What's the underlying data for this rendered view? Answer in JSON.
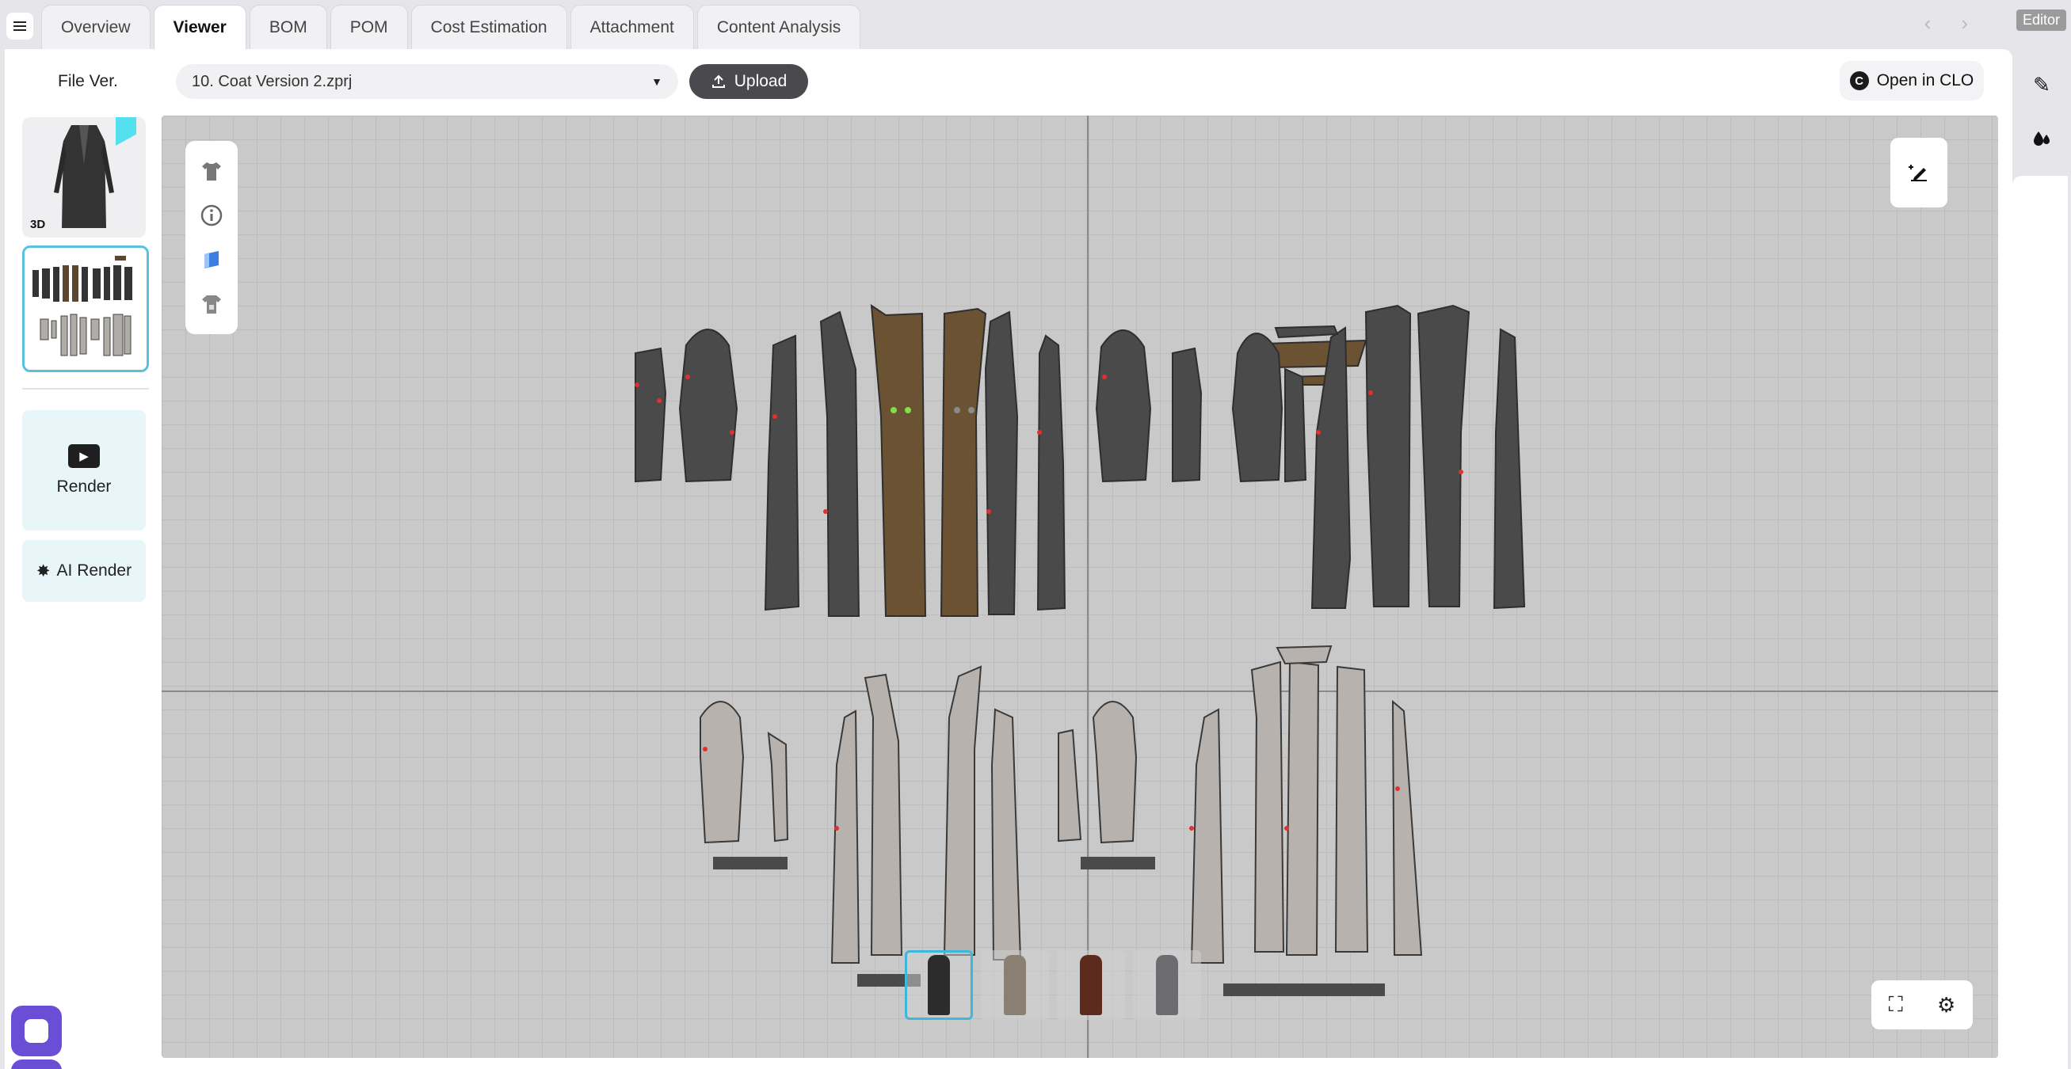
{
  "tabs": [
    {
      "label": "Overview"
    },
    {
      "label": "Viewer"
    },
    {
      "label": "BOM"
    },
    {
      "label": "POM"
    },
    {
      "label": "Cost Estimation"
    },
    {
      "label": "Attachment"
    },
    {
      "label": "Content Analysis"
    }
  ],
  "editor_badge": "Editor",
  "file": {
    "label": "File Ver.",
    "selected": "10. Coat Version 2.zprj",
    "upload_label": "Upload",
    "open_label": "Open in CLO"
  },
  "thumbs": {
    "three_d_badge": "3D"
  },
  "render": {
    "render_label": "Render",
    "ai_render_label": "AI Render"
  },
  "colors": {
    "accent": "#58c1dc",
    "chat": "#6b4ed6",
    "pattern_dark": "#4a4a4a",
    "pattern_brown": "#6b5233",
    "pattern_light": "#b7b2ad"
  },
  "colorways": [
    {
      "name": "black",
      "color": "#2c2c2c",
      "selected": true
    },
    {
      "name": "beige",
      "color": "#8a7f73",
      "selected": false
    },
    {
      "name": "brown",
      "color": "#5d2a1e",
      "selected": false
    },
    {
      "name": "grey",
      "color": "#6c6c70",
      "selected": false
    }
  ]
}
